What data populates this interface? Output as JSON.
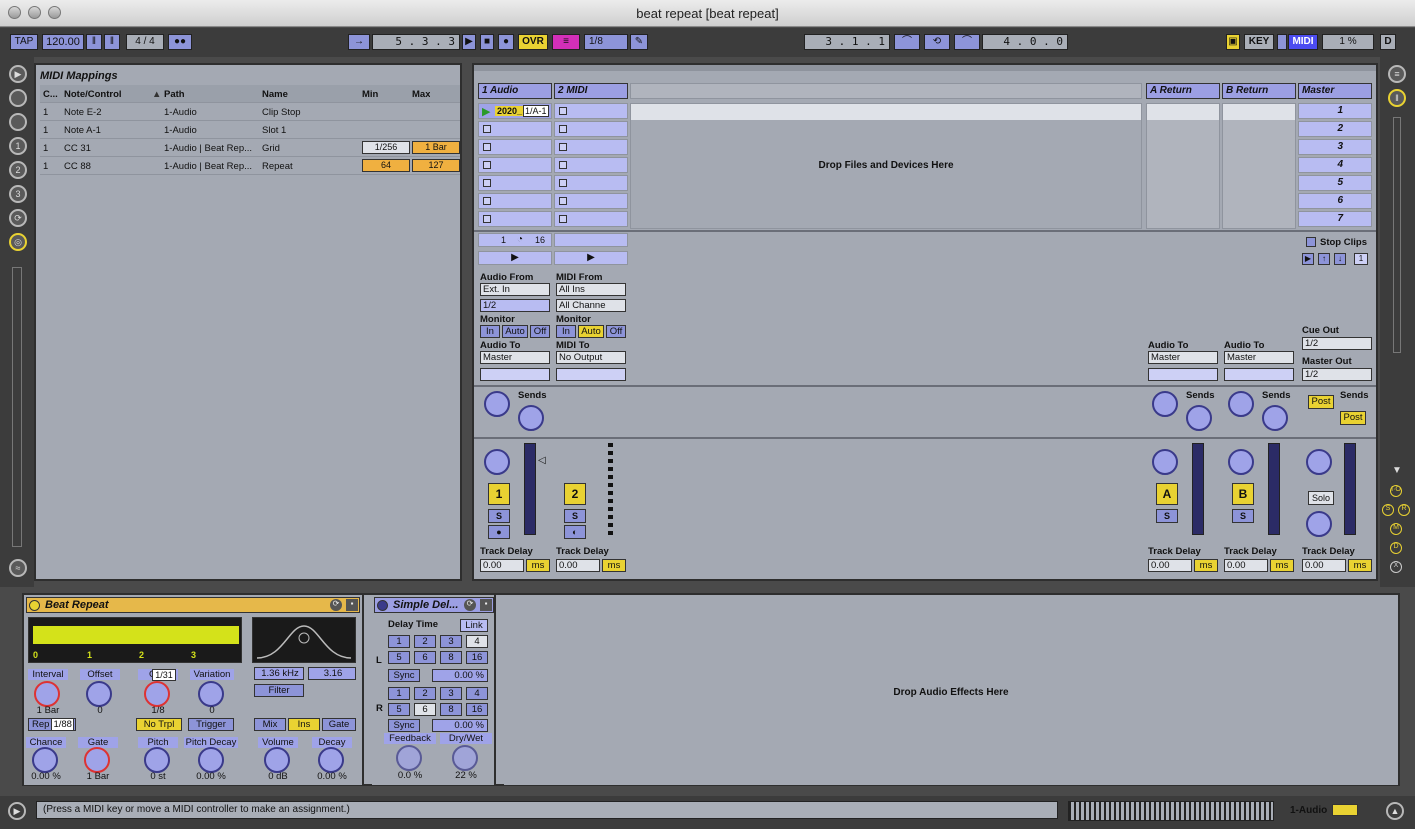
{
  "window": {
    "title": "beat repeat  [beat repeat]"
  },
  "control_bar": {
    "tap": "TAP",
    "tempo": "120.00",
    "signature": "4 / 4",
    "arrangement_position": "5 .  3 .  3",
    "overdub": "OVR",
    "quantize": "1/8",
    "loop_start": "3 .  1 .  1",
    "loop_length": "4 .  0 .  0",
    "key": "KEY",
    "midi": "MIDI",
    "cpu": "1 %",
    "d": "D"
  },
  "mapping_browser": {
    "title": "MIDI Mappings",
    "columns": [
      "C...",
      "Note/Control",
      "Path",
      "Name",
      "Min",
      "Max"
    ],
    "rows": [
      {
        "ch": "1",
        "note": "Note E-2",
        "path": "1-Audio",
        "name": "Clip Stop",
        "min": "",
        "max": ""
      },
      {
        "ch": "1",
        "note": "Note A-1",
        "path": "1-Audio",
        "name": "Slot 1",
        "min": "",
        "max": ""
      },
      {
        "ch": "1",
        "note": "CC 31",
        "path": "1-Audio | Beat Rep...",
        "name": "Grid",
        "min": "1/256",
        "max": "1 Bar"
      },
      {
        "ch": "1",
        "note": "CC 88",
        "path": "1-Audio | Beat Rep...",
        "name": "Repeat",
        "min": "64",
        "max": "127"
      }
    ]
  },
  "session": {
    "tracks": [
      {
        "name": "1 Audio",
        "clip": "2020_",
        "clip2": "1/A-1"
      },
      {
        "name": "2 MIDI"
      }
    ],
    "returns": [
      {
        "name": "A Return"
      },
      {
        "name": "B Return"
      }
    ],
    "master": {
      "name": "Master",
      "scenes": [
        "1",
        "2",
        "3",
        "4",
        "5",
        "6",
        "7"
      ],
      "stop_clips": "Stop Clips",
      "scene_num": "1"
    },
    "drop_files": "Drop Files and Devices Here",
    "audio_track": {
      "clip_info": "1",
      "clip_info2": "16",
      "io_label": "Audio From",
      "input_type": "Ext. In",
      "input_channel": "1/2",
      "monitor_label": "Monitor",
      "monitor": [
        "In",
        "Auto",
        "Off"
      ],
      "out_label": "Audio To",
      "out": "Master",
      "number": "1",
      "solo": "S",
      "delay_label": "Track Delay",
      "delay": "0.00",
      "ms": "ms",
      "sends": "Sends"
    },
    "midi_track": {
      "io_label": "MIDI From",
      "input_type": "All Ins",
      "input_channel": "All Channe",
      "monitor_label": "Monitor",
      "monitor": [
        "In",
        "Auto",
        "Off"
      ],
      "out_label": "MIDI To",
      "out": "No Output",
      "number": "2",
      "solo": "S",
      "delay_label": "Track Delay",
      "delay": "0.00",
      "ms": "ms"
    },
    "return_a": {
      "out_label": "Audio To",
      "out": "Master",
      "sends": "Sends",
      "letter": "A",
      "solo": "S",
      "delay_label": "Track Delay",
      "delay": "0.00",
      "ms": "ms"
    },
    "return_b": {
      "out_label": "Audio To",
      "out": "Master",
      "sends": "Sends",
      "letter": "B",
      "solo": "S",
      "delay_label": "Track Delay",
      "delay": "0.00",
      "ms": "ms"
    },
    "master_io": {
      "cue_label": "Cue Out",
      "cue": "1/2",
      "master_label": "Master Out",
      "master": "1/2",
      "sends": "Sends",
      "post": "Post",
      "solo": "Solo",
      "delay_label": "Track Delay",
      "delay": "0.00",
      "ms": "ms"
    }
  },
  "beat_repeat": {
    "title": "Beat Repeat",
    "ruler": [
      "0",
      "1",
      "2",
      "3"
    ],
    "filter_freq": "1.36 kHz",
    "filter_q": "3.16",
    "filter": "Filter",
    "interval": {
      "label": "Interval",
      "value": "1 Bar"
    },
    "offset": {
      "label": "Offset",
      "value": "0"
    },
    "grid": {
      "label": "Grid",
      "value": "1/8",
      "tooltip": "1/31"
    },
    "variation": {
      "label": "Variation",
      "value": "0"
    },
    "repeat": {
      "label": "Rep",
      "tooltip": "1/88"
    },
    "no_trpl": "No Trpl",
    "trigger": "Trigger",
    "mix": "Mix",
    "ins": "Ins",
    "gate_btn": "Gate",
    "chance": {
      "label": "Chance",
      "value": "0.00 %"
    },
    "gate": {
      "label": "Gate",
      "value": "1 Bar"
    },
    "pitch": {
      "label": "Pitch",
      "value": "0 st"
    },
    "pitch_decay": {
      "label": "Pitch Decay",
      "value": "0.00 %"
    },
    "volume": {
      "label": "Volume",
      "value": "0 dB"
    },
    "decay": {
      "label": "Decay",
      "value": "0.00 %"
    }
  },
  "simple_delay": {
    "title": "Simple Del...",
    "delay_time": "Delay Time",
    "link": "Link",
    "l": "L",
    "r": "R",
    "beats": [
      "1",
      "2",
      "3",
      "4",
      "5",
      "6",
      "8",
      "16"
    ],
    "sync": "Sync",
    "offset_l": "0.00 %",
    "offset_r": "0.00 %",
    "feedback": {
      "label": "Feedback",
      "value": "0.0 %"
    },
    "drywet": {
      "label": "Dry/Wet",
      "value": "22 %"
    }
  },
  "drop_effects": "Drop Audio Effects Here",
  "status": {
    "message": "(Press a MIDI key or move a MIDI controller to make an assignment.)",
    "track": "1-Audio"
  }
}
